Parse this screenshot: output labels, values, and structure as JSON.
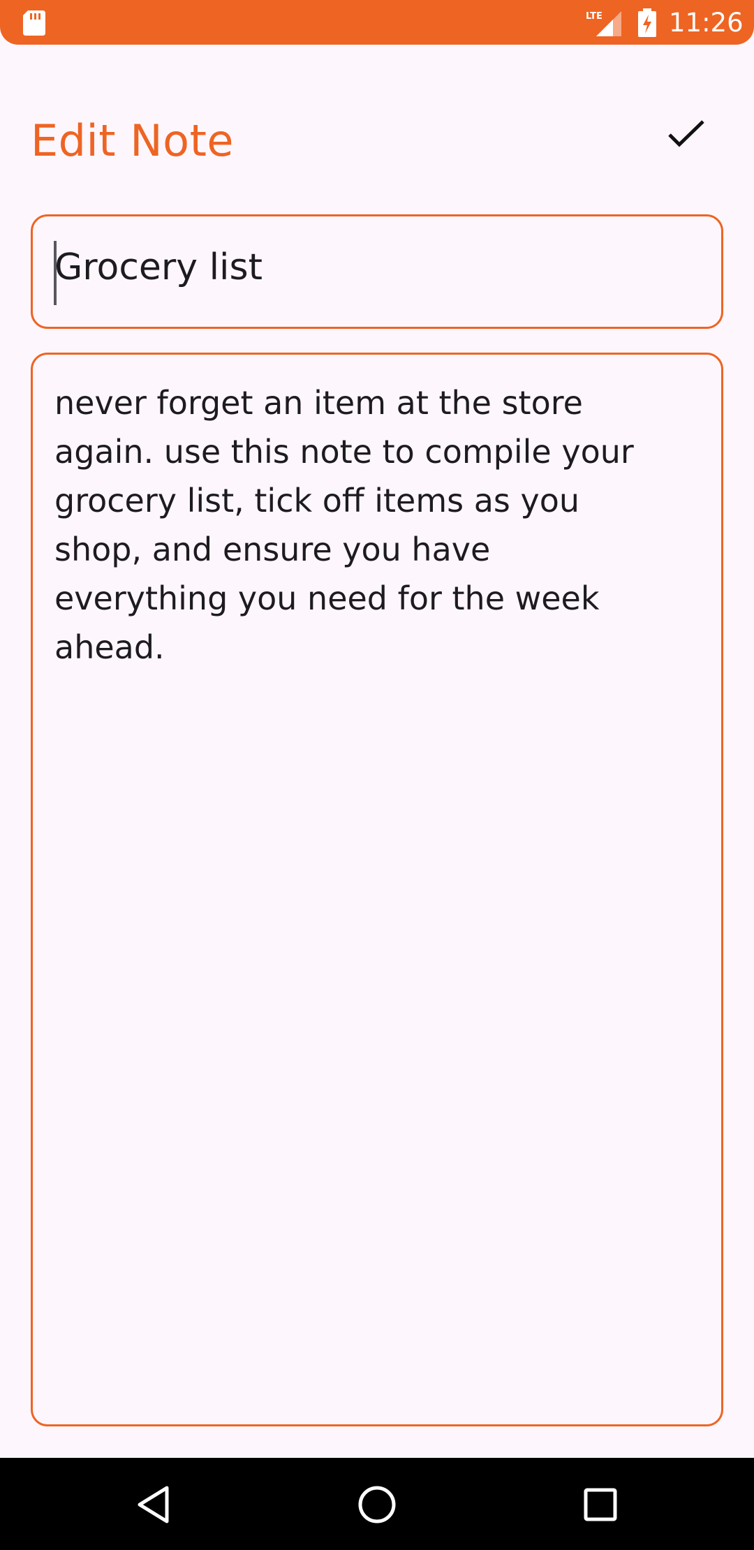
{
  "status_bar": {
    "time": "11:26",
    "network_label": "LTE",
    "accent_color": "#ee6423",
    "icons": [
      "sd-card-icon",
      "lte-signal-icon",
      "battery-charging-icon"
    ]
  },
  "header": {
    "title": "Edit Note",
    "save_icon": "check-icon"
  },
  "note": {
    "title_value": "Grocery list",
    "body_value": "never forget an item at the store\nagain. use this note to compile your\ngrocery list, tick off items as you\nshop, and ensure you have\neverything you need for the week\nahead."
  },
  "nav_bar": {
    "icons": [
      "back-triangle-icon",
      "home-circle-icon",
      "recents-square-icon"
    ]
  },
  "colors": {
    "accent": "#ee6423",
    "background": "#fdf7fd",
    "text": "#1e1b20"
  }
}
